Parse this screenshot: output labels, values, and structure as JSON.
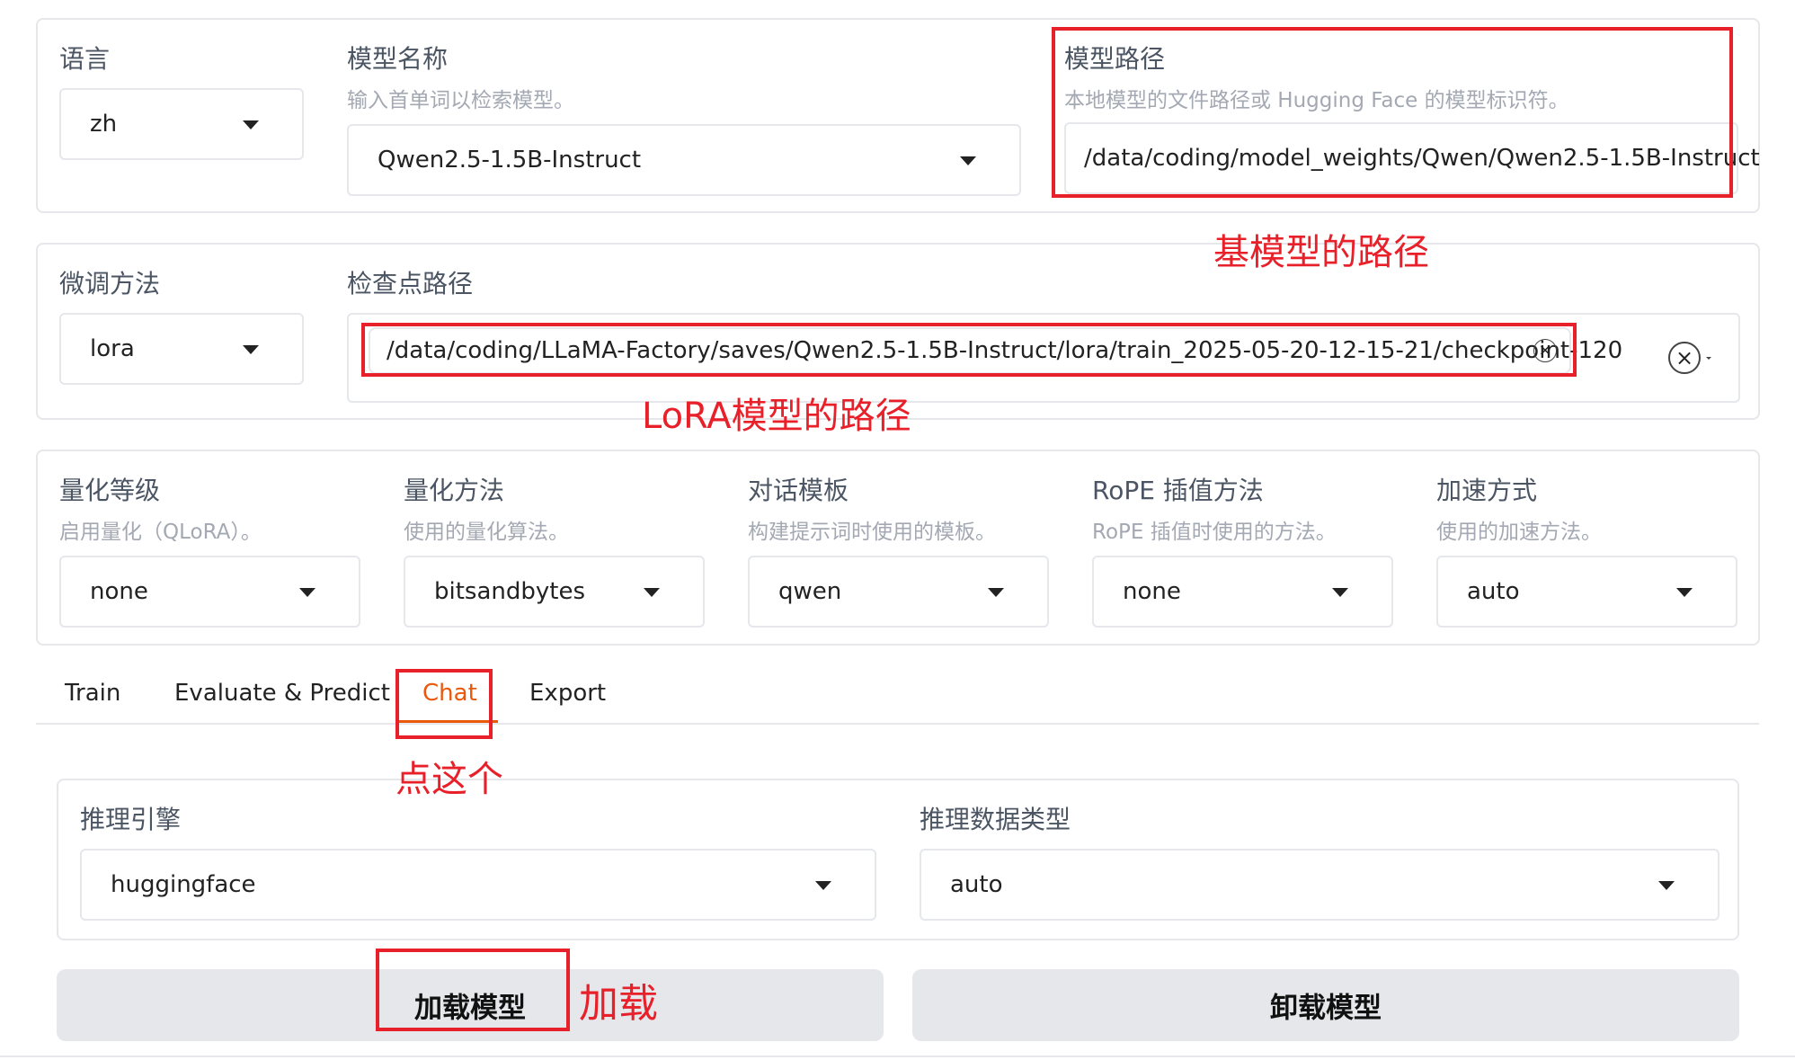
{
  "model": {
    "lang_label": "语言",
    "lang_value": "zh",
    "name_label": "模型名称",
    "name_info": "输入首单词以检索模型。",
    "name_value": "Qwen2.5-1.5B-Instruct",
    "path_label": "模型路径",
    "path_info": "本地模型的文件路径或 Hugging Face 的模型标识符。",
    "path_value": "/data/coding/model_weights/Qwen/Qwen2.5-1.5B-Instruct"
  },
  "finetune": {
    "method_label": "微调方法",
    "method_value": "lora",
    "ckpt_label": "检查点路径",
    "ckpt_value": "/data/coding/LLaMA-Factory/saves/Qwen2.5-1.5B-Instruct/lora/train_2025-05-20-12-15-21/checkpoint-120"
  },
  "advanced": {
    "quant_bit": {
      "label": "量化等级",
      "info": "启用量化（QLoRA）。",
      "value": "none"
    },
    "quant_method": {
      "label": "量化方法",
      "info": "使用的量化算法。",
      "value": "bitsandbytes"
    },
    "template": {
      "label": "对话模板",
      "info": "构建提示词时使用的模板。",
      "value": "qwen"
    },
    "rope": {
      "label": "RoPE 插值方法",
      "info": "RoPE 插值时使用的方法。",
      "value": "none"
    },
    "booster": {
      "label": "加速方式",
      "info": "使用的加速方法。",
      "value": "auto"
    }
  },
  "tabs": [
    {
      "label": "Train"
    },
    {
      "label": "Evaluate & Predict"
    },
    {
      "label": "Chat"
    },
    {
      "label": "Export"
    }
  ],
  "chat": {
    "backend_label": "推理引擎",
    "backend_value": "huggingface",
    "dtype_label": "推理数据类型",
    "dtype_value": "auto",
    "load_button": "加载模型",
    "unload_button": "卸载模型"
  },
  "annotations": {
    "base_path": "基模型的路径",
    "lora_path": "LoRA模型的路径",
    "click_this": "点这个",
    "load": "加载"
  },
  "colors": {
    "accent": "#ea580c",
    "annotation": "#e8202a",
    "button_bg": "#e5e7eb"
  }
}
